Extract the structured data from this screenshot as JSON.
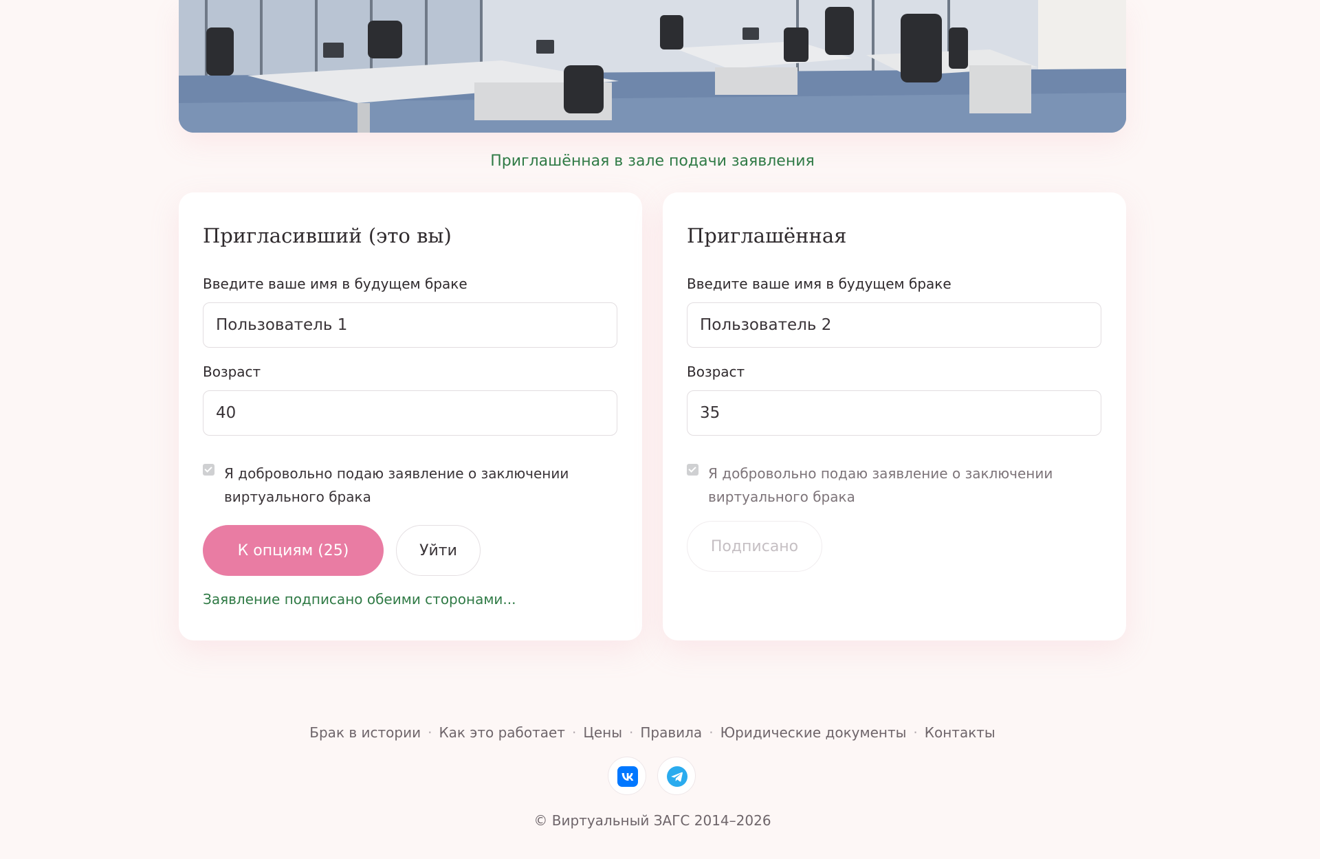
{
  "hero": {
    "caption": "Приглашённая в зале подачи заявления"
  },
  "inviter": {
    "heading": "Пригласивший (это вы)",
    "name_label": "Введите ваше имя в будущем браке",
    "name_value": "Пользователь 1",
    "age_label": "Возраст",
    "age_value": "40",
    "consent_text": "Я добровольно подаю заявление о заключении виртуального брака",
    "consent_checked": true,
    "options_button": "К опциям (25)",
    "leave_button": "Уйти",
    "status_text": "Заявление подписано обеими сторонами..."
  },
  "invitee": {
    "heading": "Приглашённая",
    "name_label": "Введите ваше имя в будущем браке",
    "name_value": "Пользователь 2",
    "age_label": "Возраст",
    "age_value": "35",
    "consent_text": "Я добровольно подаю заявление о заключении виртуального брака",
    "consent_checked": true,
    "signed_button": "Подписано"
  },
  "footer": {
    "links": [
      "Брак в истории",
      "Как это работает",
      "Цены",
      "Правила",
      "Юридические документы",
      "Контакты"
    ],
    "socials": [
      {
        "name": "vk-icon",
        "color": "#0077ff"
      },
      {
        "name": "telegram-icon",
        "color": "#2aabee"
      }
    ],
    "copyright": "© Виртуальный ЗАГС 2014–2026"
  },
  "colors": {
    "accent": "#e97ca3",
    "success_text": "#2f7a45",
    "background": "#fdf7f6"
  }
}
